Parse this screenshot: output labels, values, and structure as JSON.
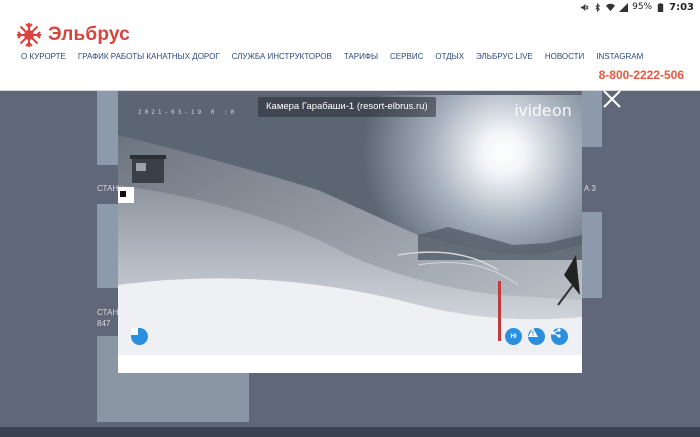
{
  "status_bar": {
    "battery": "95%",
    "time": "7:03"
  },
  "header": {
    "logo_text": "Эльбрус",
    "phone": "8-800-2222-506",
    "nav": [
      {
        "label": "О курорте"
      },
      {
        "label": "График работы канатных дорог"
      },
      {
        "label": "Служба инструкторов"
      },
      {
        "label": "Тарифы"
      },
      {
        "label": "Сервис"
      },
      {
        "label": "Отдых"
      },
      {
        "label": "Эльбрус LIVE"
      },
      {
        "label": "Новости"
      },
      {
        "label": "Instagram"
      }
    ]
  },
  "background": {
    "labels": [
      "СТАН",
      "А 3",
      "СТАН",
      "847"
    ]
  },
  "modal": {
    "camera_title": "Камера Гарабаши-1 (resort-elbrus.ru)",
    "timestamp": "2021-03-19 0 :0",
    "watermark": "ivideon",
    "controls": {
      "hd_label": "HI"
    }
  },
  "colors": {
    "brand_red": "#d9433c",
    "phone_orange": "#e9573f",
    "nav_blue": "#2f4a7a",
    "control_blue": "#2a8fde"
  },
  "icons": [
    "logo-snowflake-icon",
    "stop-icon",
    "warning-icon",
    "share-icon",
    "close-icon",
    "wifi-icon",
    "signal-icon",
    "battery-icon"
  ]
}
